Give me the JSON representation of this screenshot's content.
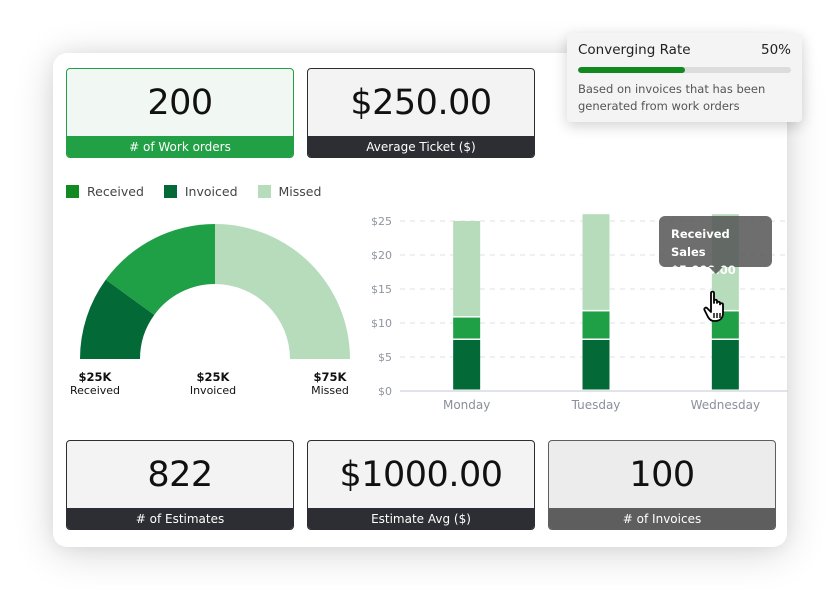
{
  "stats_top": [
    {
      "value": "200",
      "label": "# of  Work orders",
      "style": "green"
    },
    {
      "value": "$250.00",
      "label": "Average Ticket ($)",
      "style": "dark"
    }
  ],
  "stats_bottom": [
    {
      "value": "822",
      "label": "# of Estimates",
      "style": "dark"
    },
    {
      "value": "$1000.00",
      "label": "Estimate Avg ($)",
      "style": "dark"
    },
    {
      "value": "100",
      "label": "# of Invoices",
      "style": "gray"
    }
  ],
  "colors": {
    "received": "#1fa046",
    "invoiced": "#036a37",
    "missed": "#b6dcbc",
    "legend_received": "#118a22"
  },
  "legend": [
    {
      "name": "Received",
      "color": "#118a22"
    },
    {
      "name": "Invoiced",
      "color": "#036a37"
    },
    {
      "name": "Missed",
      "color": "#b6dcbc"
    }
  ],
  "gauge": {
    "labels": [
      {
        "amount": "$25K",
        "name": "Received"
      },
      {
        "amount": "$25K",
        "name": "Invoiced"
      },
      {
        "amount": "$75K",
        "name": "Missed"
      }
    ],
    "segments": [
      {
        "name": "Invoiced",
        "share": 0.2,
        "color": "#036a37"
      },
      {
        "name": "Received",
        "share": 0.3,
        "color": "#1fa046"
      },
      {
        "name": "Missed",
        "share": 0.5,
        "color": "#b6dcbc"
      }
    ]
  },
  "chart_data": {
    "type": "bar",
    "stacked": true,
    "categories": [
      "Monday",
      "Tuesday",
      "Wednesday"
    ],
    "series": [
      {
        "name": "Invoiced",
        "color": "#036a37",
        "values": [
          7.5,
          7.5,
          7.5
        ]
      },
      {
        "name": "Received",
        "color": "#1fa046",
        "values": [
          3.3,
          4.2,
          4.2
        ]
      },
      {
        "name": "Missed",
        "color": "#b6dcbc",
        "values": [
          14.2,
          14.3,
          14.3
        ]
      }
    ],
    "y_ticks": [
      "$0",
      "$5",
      "$10",
      "$15",
      "$20",
      "$25"
    ],
    "ylim": [
      0,
      25
    ],
    "grid": true,
    "highlighted_category": "Wednesday"
  },
  "tooltip": {
    "title": "Received Sales",
    "value": "$5,000.00"
  },
  "converging_rate": {
    "title": "Converging Rate",
    "percent_label": "50%",
    "percent": 50,
    "description": "Based on invoices that has been generated from work orders"
  }
}
